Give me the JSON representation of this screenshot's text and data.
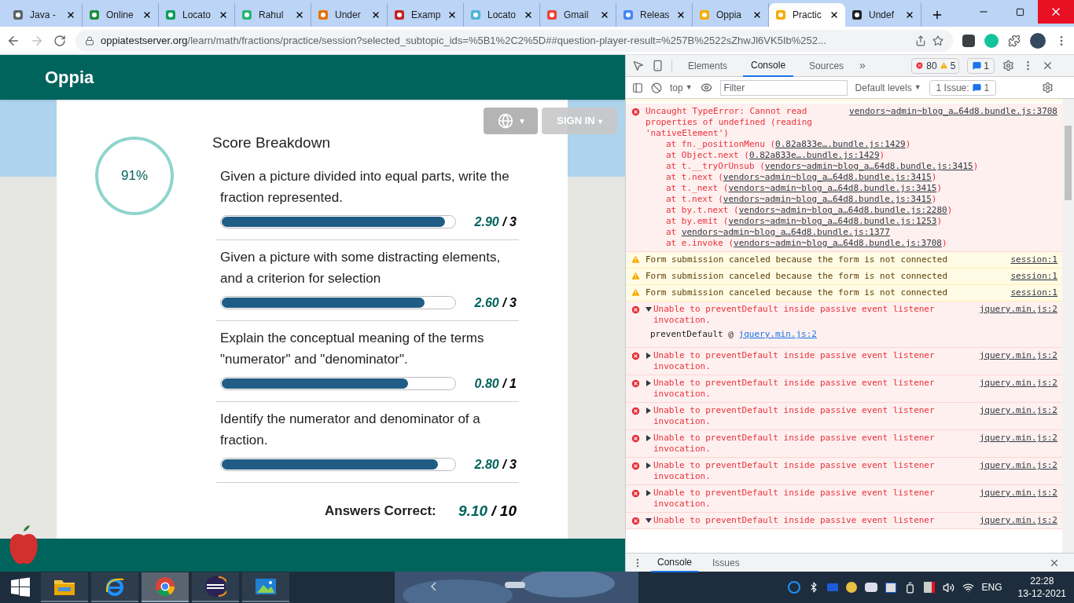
{
  "browser": {
    "tabs": [
      {
        "label": "Java -",
        "color": "#5f6368",
        "selected": false
      },
      {
        "label": "Online",
        "color": "#1e8e3e",
        "selected": false
      },
      {
        "label": "Locato",
        "color": "#0f9d58",
        "selected": false
      },
      {
        "label": "Rahul",
        "color": "#2bb673",
        "selected": false
      },
      {
        "label": "Under",
        "color": "#e8710a",
        "selected": false
      },
      {
        "label": "Examp",
        "color": "#c5221f",
        "selected": false
      },
      {
        "label": "Locato",
        "color": "#4fb3d9",
        "selected": false
      },
      {
        "label": "Gmail",
        "color": "#ea4335",
        "selected": false
      },
      {
        "label": "Releas",
        "color": "#4285f4",
        "selected": false
      },
      {
        "label": "Oppia",
        "color": "#f9ab00",
        "selected": false
      },
      {
        "label": "Practic",
        "color": "#f9ab00",
        "selected": true
      },
      {
        "label": "Undef",
        "color": "#202124",
        "selected": false
      }
    ],
    "url_host": "oppiatestserver.org",
    "url_path": "/learn/math/fractions/practice/session?selected_subtopic_ids=%5B1%2C2%5D##question-player-result=%257B%2522sZhwJl6VK5Ib%252..."
  },
  "page": {
    "logo": "Oppia",
    "globe_caret": "▾",
    "sign_in": "SIGN IN",
    "sign_in_caret": "▾",
    "score": "91%",
    "heading": "Score Breakdown",
    "skills": [
      {
        "text": "Given a picture divided into equal parts, write the fraction represented.",
        "level": 0.96,
        "score": "2.90",
        "separator": "/",
        "total": "3"
      },
      {
        "text": "Given a picture with some distracting elements, and a criterion for selection",
        "level": 0.87,
        "score": "2.60",
        "separator": "/",
        "total": "3"
      },
      {
        "text": "Explain the conceptual meaning of the terms \"numerator\" and \"denominator\".",
        "level": 0.8,
        "score": "0.80",
        "separator": "/",
        "total": "1"
      },
      {
        "text": "Identify the numerator and denominator of a fraction.",
        "level": 0.93,
        "score": "2.80",
        "separator": "/",
        "total": "3"
      }
    ],
    "answers_label": "Answers Correct:",
    "answers_score": "9.10",
    "answers_separator": "/",
    "answers_total": "10"
  },
  "devtools": {
    "tabs": [
      {
        "label": "Elements",
        "selected": false
      },
      {
        "label": "Console",
        "selected": true
      },
      {
        "label": "Sources",
        "selected": false
      }
    ],
    "more": "»",
    "errors": "80",
    "warnings": "5",
    "messages": "1",
    "context": "top",
    "context_caret": "▼",
    "filter_placeholder": "Filter",
    "levels": "Default levels",
    "levels_caret": "▼",
    "issues_label": "1 Issue:",
    "issues_count": "1",
    "entries": [
      {
        "kind": "error-stack",
        "text": "Uncaught TypeError: Cannot read properties of undefined (reading 'nativeElement')",
        "link": "vendors~admin~blog_a…64d8.bundle.js:3708",
        "frames": [
          {
            "prefix": "at fn._positionMenu (",
            "link": "0.82a833e….bundle.js:1429",
            "suffix": ")"
          },
          {
            "prefix": "at Object.next (",
            "link": "0.82a833e….bundle.js:1429",
            "suffix": ")"
          },
          {
            "prefix": "at t.__tryOrUnsub (",
            "link": "vendors~admin~blog_a…64d8.bundle.js:3415",
            "suffix": ")"
          },
          {
            "prefix": "at t.next (",
            "link": "vendors~admin~blog_a…64d8.bundle.js:3415",
            "suffix": ")"
          },
          {
            "prefix": "at t._next (",
            "link": "vendors~admin~blog_a…64d8.bundle.js:3415",
            "suffix": ")"
          },
          {
            "prefix": "at t.next (",
            "link": "vendors~admin~blog_a…64d8.bundle.js:3415",
            "suffix": ")"
          },
          {
            "prefix": "at by.t.next (",
            "link": "vendors~admin~blog_a…64d8.bundle.js:2280",
            "suffix": ")"
          },
          {
            "prefix": "at by.emit (",
            "link": "vendors~admin~blog_a…64d8.bundle.js:1253",
            "suffix": ")"
          },
          {
            "prefix": "at ",
            "link": "vendors~admin~blog_a…64d8.bundle.js:1377"
          },
          {
            "prefix": "at e.invoke (",
            "link": "vendors~admin~blog_a…64d8.bundle.js:3708",
            "suffix": ")"
          }
        ]
      },
      {
        "kind": "warning",
        "text": "Form submission canceled because the form is not connected",
        "link": "session:1"
      },
      {
        "kind": "warning",
        "text": "Form submission canceled because the form is not connected",
        "link": "session:1"
      },
      {
        "kind": "warning",
        "text": "Form submission canceled because the form is not connected",
        "link": "session:1"
      },
      {
        "kind": "error",
        "expanded": true,
        "text": "Unable to preventDefault inside passive event listener invocation.",
        "link": "jquery.min.js:2",
        "detail": "preventDefault @",
        "detail_link": "jquery.min.js:2"
      },
      {
        "kind": "error",
        "expanded": false,
        "text": "Unable to preventDefault inside passive event listener invocation.",
        "link": "jquery.min.js:2"
      },
      {
        "kind": "error",
        "expanded": false,
        "text": "Unable to preventDefault inside passive event listener invocation.",
        "link": "jquery.min.js:2"
      },
      {
        "kind": "error",
        "expanded": false,
        "text": "Unable to preventDefault inside passive event listener invocation.",
        "link": "jquery.min.js:2"
      },
      {
        "kind": "error",
        "expanded": false,
        "text": "Unable to preventDefault inside passive event listener invocation.",
        "link": "jquery.min.js:2"
      },
      {
        "kind": "error",
        "expanded": false,
        "text": "Unable to preventDefault inside passive event listener invocation.",
        "link": "jquery.min.js:2"
      },
      {
        "kind": "error",
        "expanded": false,
        "text": "Unable to preventDefault inside passive event listener invocation.",
        "link": "jquery.min.js:2"
      },
      {
        "kind": "error",
        "expanded": true,
        "text": "Unable to preventDefault inside passive event listener",
        "link": "jquery.min.js:2"
      }
    ],
    "drawer_tabs": [
      {
        "label": "Console",
        "selected": true
      },
      {
        "label": "Issues",
        "selected": false
      }
    ]
  },
  "taskbar": {
    "apps": [
      {
        "kind": "explorer",
        "selected": false
      },
      {
        "kind": "ie",
        "selected": false
      },
      {
        "kind": "chrome",
        "selected": true
      },
      {
        "kind": "eclipse",
        "selected": false
      },
      {
        "kind": "photos",
        "selected": false
      }
    ],
    "language": "ENG",
    "time": "22:28",
    "date": "13-12-2021"
  }
}
